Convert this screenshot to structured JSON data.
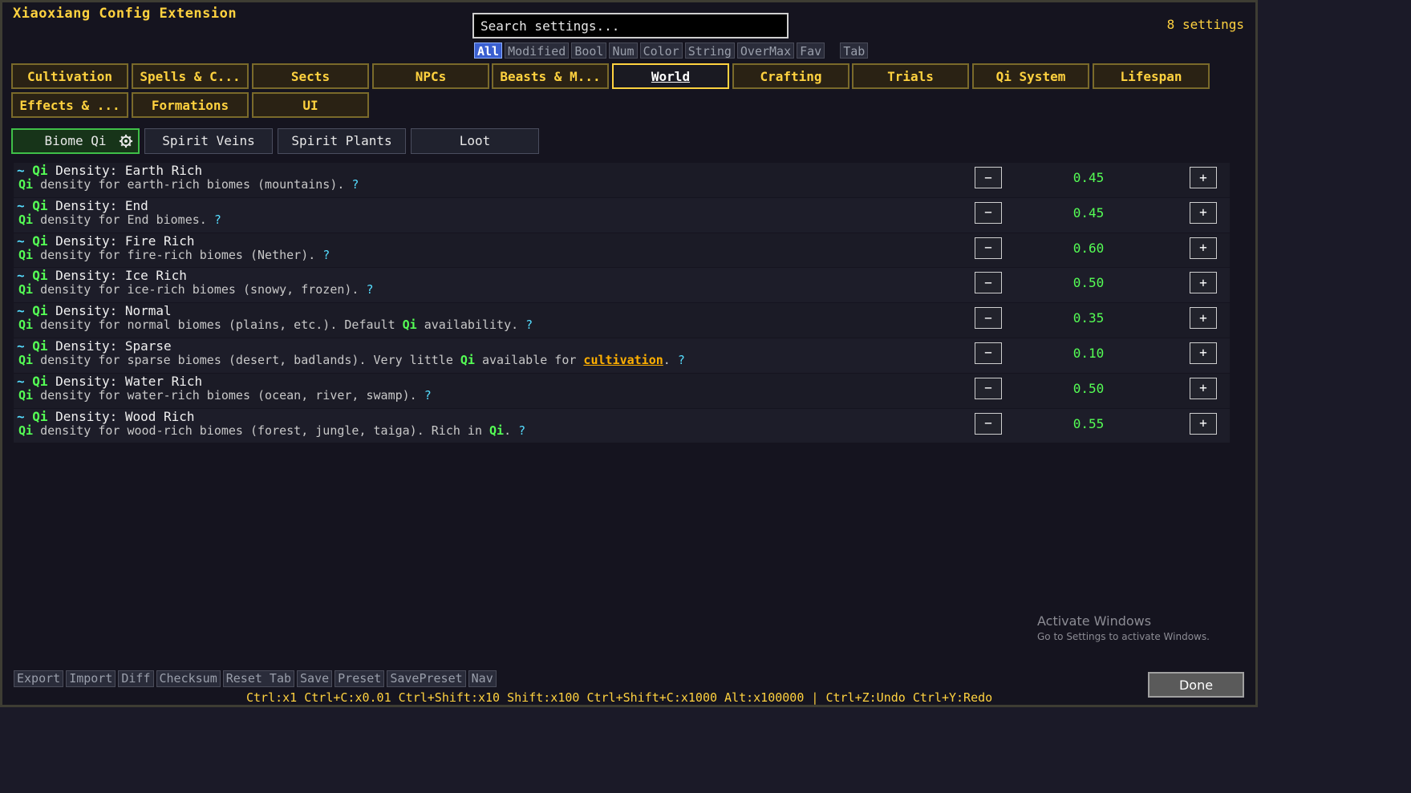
{
  "header": {
    "title": "Xiaoxiang Config Extension",
    "count": "8 settings"
  },
  "search": {
    "placeholder": "Search settings..."
  },
  "filters": [
    "All",
    "Modified",
    "Bool",
    "Num",
    "Color",
    "String",
    "OverMax",
    "Fav",
    "Tab"
  ],
  "categories": [
    "Cultivation",
    "Spells & C...",
    "Sects",
    "NPCs",
    "Beasts & M...",
    "World",
    "Crafting",
    "Trials",
    "Qi System",
    "Lifespan",
    "Effects & ...",
    "Formations",
    "UI"
  ],
  "subtabs": [
    "Biome Qi",
    "Spirit Veins",
    "Spirit Plants",
    "Loot"
  ],
  "settings": [
    {
      "prefix": "~ ",
      "qi": "Qi",
      "title": " Density: Earth Rich",
      "desc_a": " density for earth-rich biomes (mountains). ",
      "help": "?",
      "value": "0.45"
    },
    {
      "prefix": "~ ",
      "qi": "Qi",
      "title": " Density: End",
      "desc_a": " density for End biomes. ",
      "help": "?",
      "value": "0.45"
    },
    {
      "prefix": "~ ",
      "qi": "Qi",
      "title": " Density: Fire Rich",
      "desc_a": " density for fire-rich biomes (Nether). ",
      "help": "?",
      "value": "0.60"
    },
    {
      "prefix": "~ ",
      "qi": "Qi",
      "title": " Density: Ice Rich",
      "desc_a": " density for ice-rich biomes (snowy, frozen). ",
      "help": "?",
      "value": "0.50"
    },
    {
      "prefix": "~ ",
      "qi": "Qi",
      "title": " Density: Normal",
      "desc_a": " density for normal biomes (plains, etc.). Default ",
      "desc_b": " availability. ",
      "help": "?",
      "value": "0.35"
    },
    {
      "prefix": "~ ",
      "qi": "Qi",
      "title": " Density: Sparse",
      "desc_a": " density for sparse biomes (desert, badlands). Very little ",
      "desc_b": " available for ",
      "link": "cultivation",
      "desc_c": ". ",
      "help": "?",
      "value": "0.10"
    },
    {
      "prefix": "~ ",
      "qi": "Qi",
      "title": " Density: Water Rich",
      "desc_a": " density for water-rich biomes (ocean, river, swamp). ",
      "help": "?",
      "value": "0.50"
    },
    {
      "prefix": "~ ",
      "qi": "Qi",
      "title": " Density: Wood Rich",
      "desc_a": " density for wood-rich biomes (forest, jungle, taiga). Rich in ",
      "desc_b": ". ",
      "help": "?",
      "value": "0.55"
    }
  ],
  "controls": {
    "minus": "−",
    "plus": "+"
  },
  "toolbar": [
    "Export",
    "Import",
    "Diff",
    "Checksum",
    "Reset Tab",
    "Save",
    "Preset",
    "SavePreset",
    "Nav"
  ],
  "hotkeys": "Ctrl:x1  Ctrl+C:x0.01  Ctrl+Shift:x10  Shift:x100  Ctrl+Shift+C:x1000  Alt:x100000  |  Ctrl+Z:Undo  Ctrl+Y:Redo",
  "watermark": {
    "line1": "Activate Windows",
    "line2": "Go to Settings to activate Windows."
  },
  "done_label": "Done"
}
